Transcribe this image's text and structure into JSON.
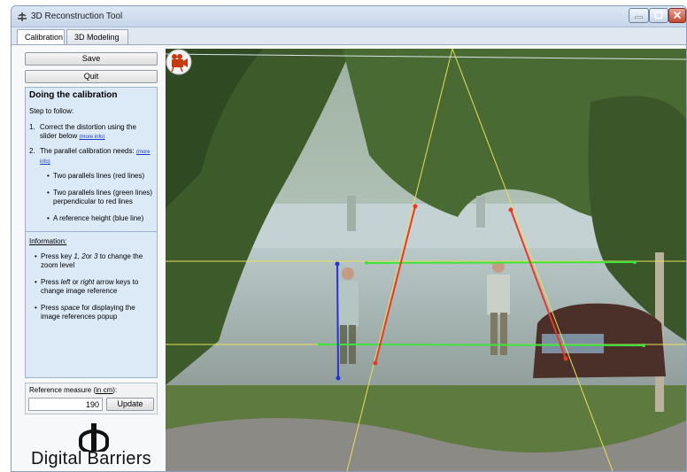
{
  "window": {
    "title": "3D Reconstruction Tool",
    "icon": "app-icon"
  },
  "tabs": [
    {
      "label": "Calibration",
      "active": true
    },
    {
      "label": "3D Modeling",
      "active": false
    }
  ],
  "buttons": {
    "save": "Save",
    "quit": "Quit"
  },
  "guide": {
    "heading": "Doing the calibration",
    "intro": "Step to follow:",
    "steps": [
      {
        "num": "1.",
        "text": "Correct the distortion using the slider below",
        "more": "(more info)"
      },
      {
        "num": "2.",
        "text": "The parallel calibration needs:",
        "more": "(more info)"
      }
    ],
    "needs": [
      "Two parallels lines (red lines)",
      "Two parallels lines (green lines) perpendicular to red lines",
      "A reference height (blue line)"
    ],
    "info_title": "Information:",
    "info": [
      {
        "pre": "Press key ",
        "em": "1, 2",
        "mid": "or ",
        "em2": "3",
        "post": " to change the zoom level"
      },
      {
        "pre": "Press ",
        "em": "left",
        "mid": " or ",
        "em2": "right",
        "post": " arrow keys to change image reference"
      },
      {
        "pre": "Press ",
        "em": "space",
        "mid": "",
        "em2": "",
        "post": " for displaying the image references popup"
      }
    ],
    "bullet": "•"
  },
  "reference": {
    "label_pre": "Reference measure (",
    "label_unit": "in cm",
    "label_post": "):",
    "value": "190",
    "update": "Update"
  },
  "logo": {
    "text": "Digital Barriers"
  },
  "colors": {
    "red_line": "#e8392a",
    "green_line": "#3fe23f",
    "blue_line": "#2433d6",
    "yellow_line": "#e5e05a",
    "panel": "#dce9f7"
  },
  "icons": [
    "app-icon",
    "minimize-icon",
    "maximize-icon",
    "close-icon",
    "camera-icon",
    "logo-mark"
  ]
}
